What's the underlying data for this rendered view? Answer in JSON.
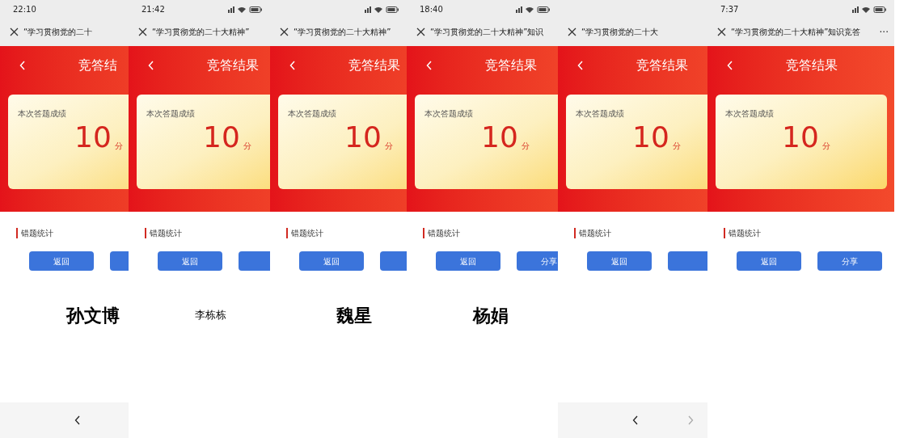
{
  "panels": [
    {
      "time": "22:10",
      "status_icons": false,
      "nav_title": "“学习贯彻党的二十",
      "header_title": "竞答结",
      "score_label": "本次答题成绩",
      "score": "10",
      "unit": "分",
      "section": "错题统计",
      "back_button": "返回",
      "name": "孙文博",
      "name_bold": true,
      "bottom_nav": true
    },
    {
      "time": "21:42",
      "status_icons": true,
      "nav_title": "“学习贯彻党的二十大精神”",
      "header_title": "竞答结果",
      "score_label": "本次答题成绩",
      "score": "10",
      "unit": "分",
      "section": "错题统计",
      "back_button": "返回",
      "name": "李栋栋",
      "name_bold": false
    },
    {
      "status_icons": true,
      "nav_title": "“学习贯彻党的二十大精神”",
      "header_title": "竞答结果",
      "score_label": "本次答题成绩",
      "score": "10",
      "unit": "分",
      "section": "错题统计",
      "back_button": "返回",
      "name": "魏星",
      "name_bold": true
    },
    {
      "time": "18:40",
      "status_icons": true,
      "nav_title": "“学习贯彻党的二十大精神”知识",
      "header_title": "竞答结果",
      "score_label": "本次答题成绩",
      "score": "10",
      "unit": "分",
      "section": "错题统计",
      "back_button": "返回",
      "share_button": "分享",
      "name": "杨娟",
      "name_bold": true
    },
    {
      "nav_title": "“学习贯彻党的二十大",
      "header_title": "竞答结果",
      "score_label": "本次答题成绩",
      "score": "10",
      "unit": "分",
      "section": "错题统计",
      "back_button": "返回",
      "bottom_nav": {
        "forward": true
      }
    },
    {
      "time": "7:37",
      "status_icons": true,
      "nav_title": "“学习贯彻党的二十大精神”知识竞答",
      "more": "···",
      "header_title": "竞答结果",
      "score_label": "本次答题成绩",
      "score": "10",
      "unit": "分",
      "section": "错题统计",
      "back_button": "返回",
      "share_button": "分享"
    }
  ]
}
